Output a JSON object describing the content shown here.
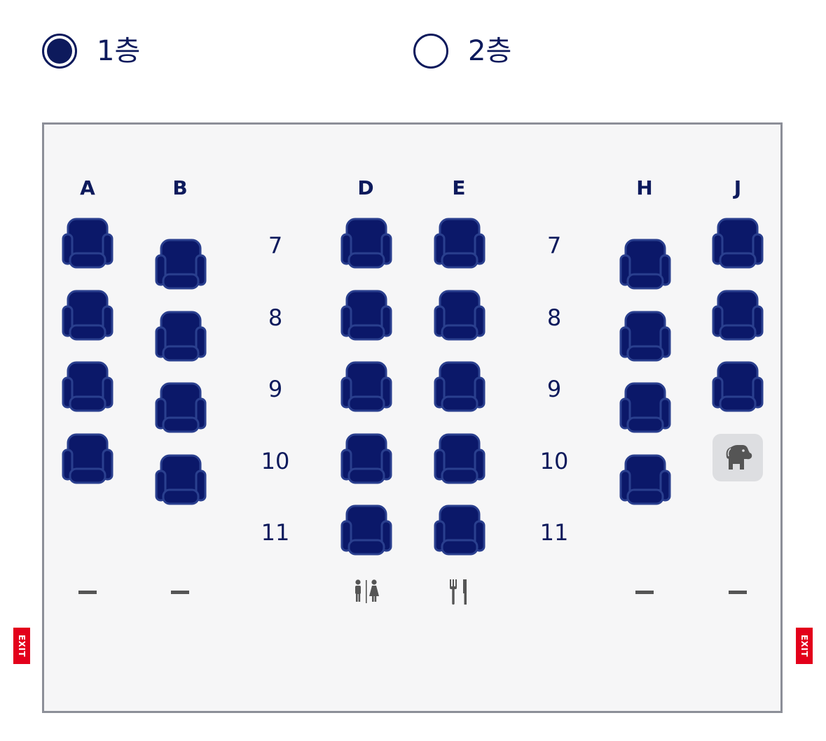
{
  "deck_selector": {
    "options": [
      {
        "label": "1층",
        "selected": true
      },
      {
        "label": "2층",
        "selected": false
      }
    ]
  },
  "columns": [
    "A",
    "B",
    "D",
    "E",
    "H",
    "J"
  ],
  "rows": [
    "7",
    "8",
    "9",
    "10",
    "11"
  ],
  "exit_label": "EXIT",
  "colors": {
    "seat": "#0b1869",
    "seat_outline": "#2a3f8e",
    "accent": "#0d1a5c",
    "exit": "#e3001b",
    "pet_bg": "#dddee1"
  },
  "icons": {
    "pet_seat": "dog-icon",
    "restroom": "restroom-icon",
    "galley": "galley-icon"
  }
}
